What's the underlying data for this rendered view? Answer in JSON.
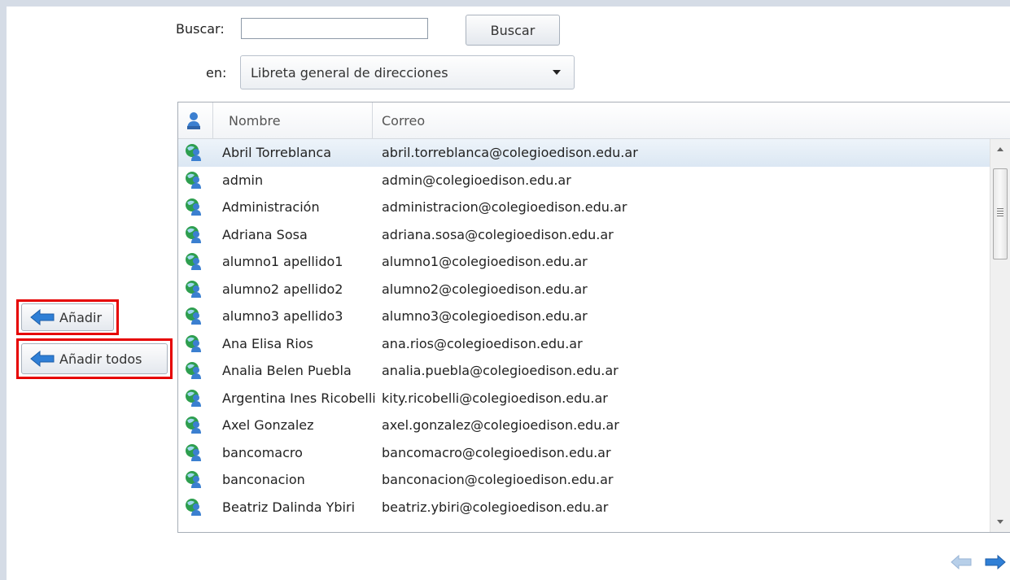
{
  "search": {
    "label": "Buscar:",
    "value": "",
    "button_label": "Buscar"
  },
  "scope": {
    "label": "en:",
    "selected": "Libreta general de direcciones"
  },
  "table": {
    "columns": {
      "icon": "person-icon",
      "name": "Nombre",
      "email": "Correo"
    },
    "rows": [
      {
        "name": "Abril Torreblanca",
        "email": "abril.torreblanca@colegioedison.edu.ar",
        "selected": true
      },
      {
        "name": "admin",
        "email": "admin@colegioedison.edu.ar"
      },
      {
        "name": "Administración",
        "email": "administracion@colegioedison.edu.ar"
      },
      {
        "name": "Adriana Sosa",
        "email": "adriana.sosa@colegioedison.edu.ar"
      },
      {
        "name": "alumno1 apellido1",
        "email": "alumno1@colegioedison.edu.ar"
      },
      {
        "name": "alumno2 apellido2",
        "email": "alumno2@colegioedison.edu.ar"
      },
      {
        "name": "alumno3 apellido3",
        "email": "alumno3@colegioedison.edu.ar"
      },
      {
        "name": "Ana Elisa Rios",
        "email": "ana.rios@colegioedison.edu.ar"
      },
      {
        "name": "Analia Belen Puebla",
        "email": "analia.puebla@colegioedison.edu.ar"
      },
      {
        "name": "Argentina Ines Ricobelli",
        "email": "kity.ricobelli@colegioedison.edu.ar"
      },
      {
        "name": "Axel Gonzalez",
        "email": "axel.gonzalez@colegioedison.edu.ar"
      },
      {
        "name": "bancomacro",
        "email": "bancomacro@colegioedison.edu.ar"
      },
      {
        "name": "banconacion",
        "email": "banconacion@colegioedison.edu.ar"
      },
      {
        "name": "Beatriz Dalinda Ybiri",
        "email": "beatriz.ybiri@colegioedison.edu.ar"
      }
    ]
  },
  "actions": {
    "add_label": "Añadir",
    "add_all_label": "Añadir todos"
  },
  "colors": {
    "highlight_box": "#e60000",
    "arrow_blue": "#2f7fd6",
    "selected_row": "#dbe7f3"
  }
}
